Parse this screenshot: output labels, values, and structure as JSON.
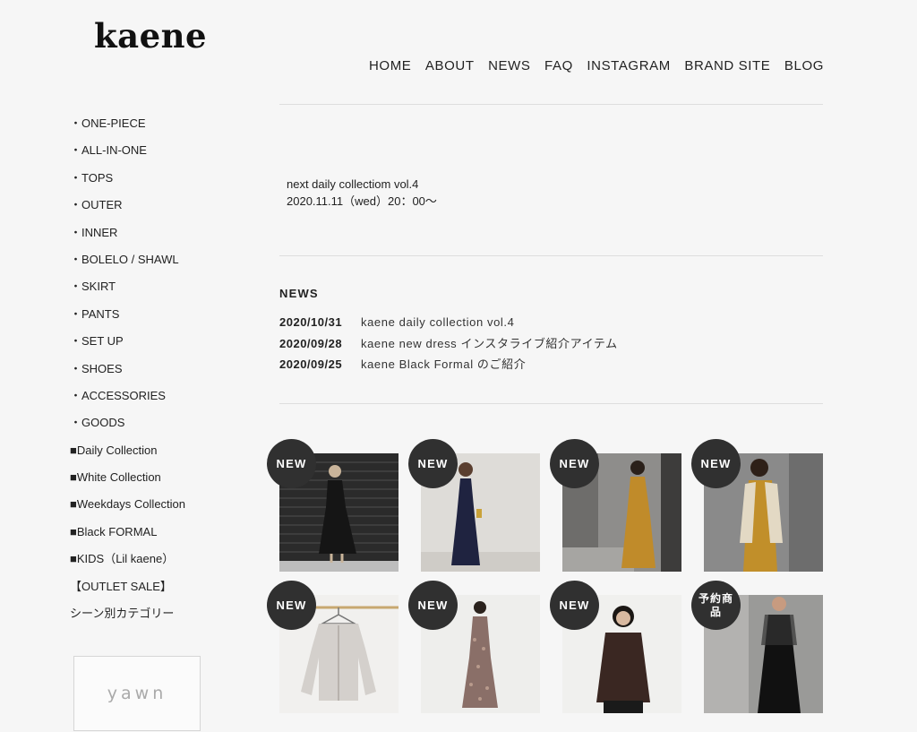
{
  "brand": {
    "logo": "kaene"
  },
  "nav": [
    "HOME",
    "ABOUT",
    "NEWS",
    "FAQ",
    "INSTAGRAM",
    "BRAND SITE",
    "BLOG"
  ],
  "sidebar": [
    "・ONE-PIECE",
    "・ALL-IN-ONE",
    "・TOPS",
    "・OUTER",
    "・INNER",
    "・BOLELO / SHAWL",
    "・SKIRT",
    "・PANTS",
    "・SET UP",
    "・SHOES",
    "・ACCESSORIES",
    "・GOODS",
    "■Daily Collection",
    "■White Collection",
    "■Weekdays Collection",
    "■Black FORMAL",
    "■KIDS（Lil kaene）",
    "【OUTLET SALE】",
    "シーン別カテゴリー"
  ],
  "banner": {
    "yawn": "yawn"
  },
  "announcement": {
    "line1": "next  daily collectiom vol.4",
    "line2": "2020.11.11（wed）20：00〜"
  },
  "news": {
    "heading": "NEWS",
    "items": [
      {
        "date": "2020/10/31",
        "title": "kaene daily collection vol.4"
      },
      {
        "date": "2020/09/28",
        "title": "kaene new dress インスタライブ紹介アイテム"
      },
      {
        "date": "2020/09/25",
        "title": "kaene Black Formal のご紹介"
      }
    ]
  },
  "products": [
    {
      "badge": "NEW"
    },
    {
      "badge": "NEW"
    },
    {
      "badge": "NEW"
    },
    {
      "badge": "NEW"
    },
    {
      "badge": "NEW"
    },
    {
      "badge": "NEW"
    },
    {
      "badge": "NEW"
    },
    {
      "badge": "予約商品"
    }
  ]
}
